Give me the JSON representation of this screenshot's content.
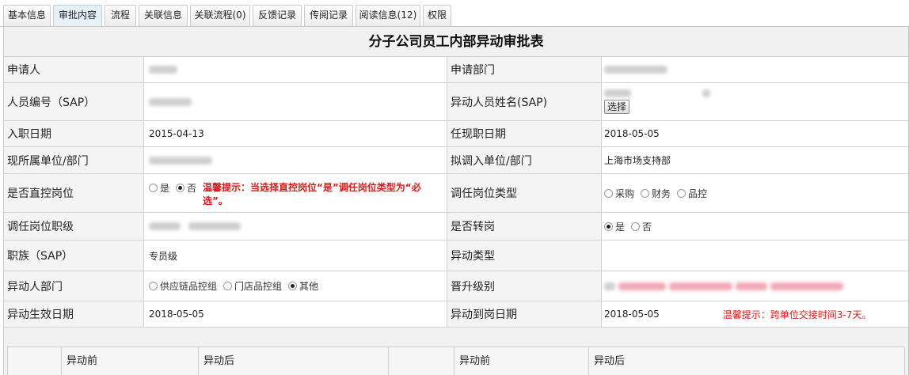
{
  "tabs": [
    {
      "label": "基本信息",
      "active": false
    },
    {
      "label": "审批内容",
      "active": true
    },
    {
      "label": "流程",
      "active": false
    },
    {
      "label": "关联信息",
      "active": false
    },
    {
      "label": "关联流程(0)",
      "active": false
    },
    {
      "label": "反馈记录",
      "active": false
    },
    {
      "label": "传阅记录",
      "active": false
    },
    {
      "label": "阅读信息(12)",
      "active": false
    },
    {
      "label": "权限",
      "active": false
    }
  ],
  "form": {
    "title": "分子公司员工内部异动审批表",
    "labels": {
      "applicant": "申请人",
      "apply_dept": "申请部门",
      "emp_no": "人员编号（SAP）",
      "moved_name": "异动人员姓名(SAP)",
      "hire_date": "入职日期",
      "current_post_date": "任现职日期",
      "current_unit": "现所属单位/部门",
      "target_unit": "拟调入单位/部门",
      "direct_ctrl": "是否直控岗位",
      "post_type": "调任岗位类型",
      "post_level": "调任岗位职级",
      "transfer": "是否转岗",
      "job_family": "职族（SAP）",
      "move_type": "异动类型",
      "move_dept": "异动人部门",
      "promote_level": "晋升级别",
      "effective_date": "异动生效日期",
      "arrival_date": "异动到岗日期"
    },
    "values": {
      "hire_date": "2015-04-13",
      "current_post_date": "2018-05-05",
      "target_unit": "上海市场支持部",
      "job_family": "专员级",
      "effective_date": "2018-05-05",
      "arrival_date": "2018-05-05"
    },
    "select_button": "选择",
    "direct_ctrl_options": [
      {
        "label": "是",
        "checked": false
      },
      {
        "label": "否",
        "checked": true
      }
    ],
    "direct_ctrl_tip": "温馨提示：当选择直控岗位“是”调任岗位类型为“必选”。",
    "post_type_options": [
      {
        "label": "采购",
        "checked": false
      },
      {
        "label": "财务",
        "checked": false
      },
      {
        "label": "品控",
        "checked": false
      }
    ],
    "transfer_options": [
      {
        "label": "是",
        "checked": true
      },
      {
        "label": "否",
        "checked": false
      }
    ],
    "move_dept_options": [
      {
        "label": "供应链品控组",
        "checked": false
      },
      {
        "label": "门店品控组",
        "checked": false
      },
      {
        "label": "其他",
        "checked": true
      }
    ],
    "arrival_tip": "温馨提示：跨单位交接时间3-7天。"
  },
  "subtable": {
    "headers": [
      "",
      "异动前",
      "异动后",
      "",
      "异动前",
      "异动后"
    ]
  },
  "colors": {
    "tip_red": "#e01a1a",
    "label_bg": "#f4f4f4",
    "active_tab_bg": "#e6f1f8"
  }
}
